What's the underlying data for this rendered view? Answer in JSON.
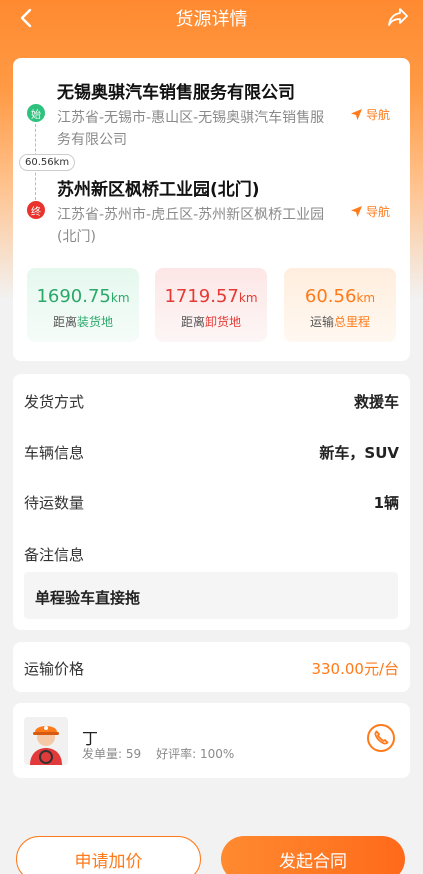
{
  "header": {
    "title": "货源详情"
  },
  "route": {
    "start": {
      "badge": "始",
      "name": "无锡奥骐汽车销售服务有限公司",
      "address": "江苏省-无锡市-惠山区-无锡奥骐汽车销售服务有限公司",
      "nav_label": "导航"
    },
    "distance_label": "60.56km",
    "end": {
      "badge": "终",
      "name": "苏州新区枫桥工业园(北门)",
      "address": "江苏省-苏州市-虎丘区-苏州新区枫桥工业园(北门)",
      "nav_label": "导航"
    },
    "stats": [
      {
        "value": "1690.75",
        "unit": "km",
        "label_prefix": "距离",
        "label_highlight": "装货地"
      },
      {
        "value": "1719.57",
        "unit": "km",
        "label_prefix": "距离",
        "label_highlight": "卸货地"
      },
      {
        "value": "60.56",
        "unit": "km",
        "label_prefix": "运输",
        "label_highlight": "总里程"
      }
    ]
  },
  "info": {
    "rows": [
      {
        "key": "发货方式",
        "value": "救援车"
      },
      {
        "key": "车辆信息",
        "value": "新车，SUV"
      },
      {
        "key": "待运数量",
        "value": "1辆"
      }
    ],
    "remark_label": "备注信息",
    "remark": "单程验车直接拖"
  },
  "price": {
    "label": "运输价格",
    "value": "330.00元/台"
  },
  "user": {
    "name": "丁",
    "orders_label": "发单量: 59",
    "rating_label": "好评率: 100%"
  },
  "actions": {
    "bid_label": "申请加价",
    "contract_label": "发起合同"
  },
  "colors": {
    "accent": "#ff7a1a",
    "green": "#2ba86a",
    "red": "#e53935"
  }
}
